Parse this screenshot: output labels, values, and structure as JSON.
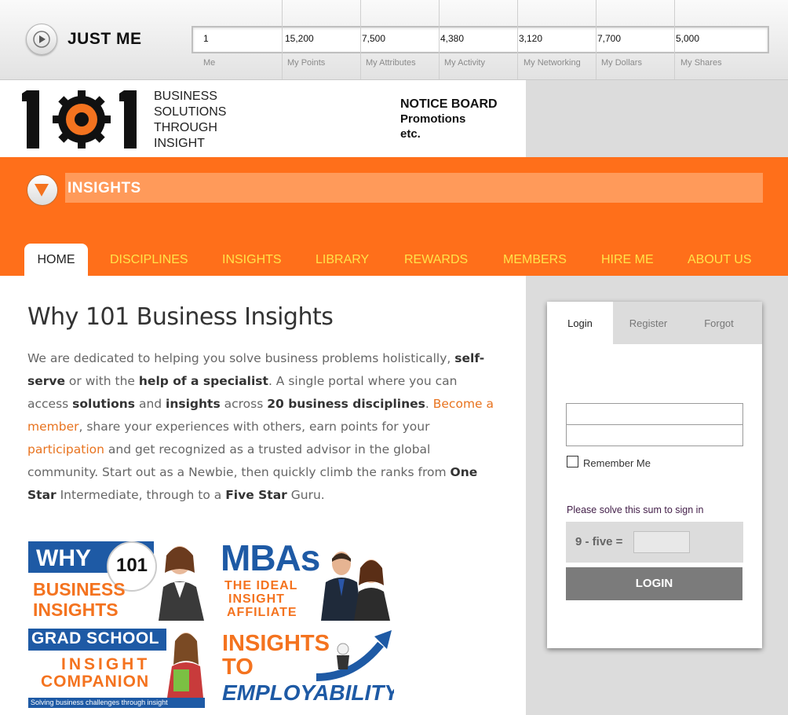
{
  "topbar": {
    "title": "JUST ME",
    "stats": [
      {
        "value": "1",
        "label": "Me"
      },
      {
        "value": "15,200",
        "label": "My Points"
      },
      {
        "value": "7,500",
        "label": "My Attributes"
      },
      {
        "value": "4,380",
        "label": "My Activity"
      },
      {
        "value": "3,120",
        "label": "My Networking"
      },
      {
        "value": "7,700",
        "label": "My Dollars"
      },
      {
        "value": "5,000",
        "label": "My Shares"
      }
    ]
  },
  "header": {
    "logo_text": "101",
    "tagline": [
      "BUSINESS",
      "SOLUTIONS",
      "THROUGH",
      "INSIGHT"
    ],
    "notice_title": "NOTICE BOARD",
    "notice_lines": [
      "Promotions",
      "etc."
    ]
  },
  "insights_bar": {
    "title": "INSIGHTS"
  },
  "nav": [
    "HOME",
    "DISCIPLINES",
    "INSIGHTS",
    "LIBRARY",
    "REWARDS",
    "MEMBERS",
    "HIRE ME",
    "ABOUT US"
  ],
  "main": {
    "headline": "Why 101 Business Insights",
    "intro": {
      "p1": "We are dedicated to helping you solve business problems holistically,",
      "b1": "self-serve",
      "p2": " or with the ",
      "b2": "help of a specialist",
      "p3": ". A single portal where you can access ",
      "b3": "solutions",
      "p4": " and ",
      "b4": "insights",
      "p5": " across ",
      "b5": "20 business disciplines",
      "p6": ". ",
      "l1": "Become a member",
      "p7": ", share your experiences with others, earn points for your ",
      "l2": "participation",
      "p8": " and get recognized as a trusted advisor in the global community. Start out as a Newbie, then quickly climb the ranks from ",
      "b6": "One Star",
      "p9": " Intermediate, through to a ",
      "b7": "Five Star",
      "p10": " Guru."
    }
  },
  "tiles": {
    "t1": {
      "top": "WHY",
      "badge": "101",
      "line1": "BUSINESS",
      "line2": "INSIGHTS"
    },
    "t2": {
      "top": "MBAs",
      "line1": "THE IDEAL",
      "line2": "INSIGHT",
      "line3": "AFFILIATE"
    },
    "t3": {
      "top": "GRAD SCHOOL",
      "line1": "INSIGHT",
      "line2": "COMPANION",
      "footer": "Solving business challenges through insight"
    },
    "t4": {
      "line1": "INSIGHTS",
      "line2": "TO",
      "line3": "EMPLOYABILITY"
    }
  },
  "login": {
    "tabs": [
      "Login",
      "Register",
      "Forgot"
    ],
    "username_value": "",
    "password_value": "",
    "remember_label": "Remember Me",
    "captcha_note": "Please solve this sum to sign in",
    "captcha_question": "9 - five =",
    "captcha_value": "",
    "button_label": "LOGIN"
  },
  "colors": {
    "brand_orange": "#ff6f1a",
    "nav_text": "#ffe34a",
    "link_orange": "#e8731f",
    "tile_blue": "#1e5aa5"
  }
}
